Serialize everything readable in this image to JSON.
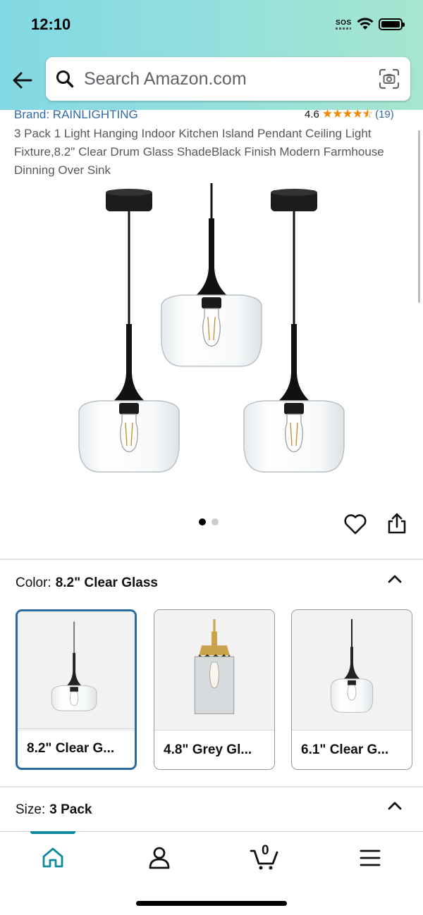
{
  "status_bar": {
    "time": "12:10",
    "sos": "SOS"
  },
  "search": {
    "placeholder": "Search Amazon.com"
  },
  "product": {
    "brand": "Brand: RAINLIGHTING",
    "rating_value": "4.6",
    "rating_stars": 4.6,
    "rating_count": "(19)",
    "title": "3 Pack 1 Light Hanging Indoor Kitchen Island Pendant Ceiling Light Fixture,8.2\" Clear Drum Glass ShadeBlack Finish Modern Farmhouse Dinning Over Sink"
  },
  "image_carousel": {
    "total": 2,
    "active_index": 0
  },
  "color": {
    "label": "Color:",
    "selected": "8.2\" Clear Glass",
    "options": [
      {
        "label": "8.2\" Clear G..."
      },
      {
        "label": "4.8\" Grey Gl..."
      },
      {
        "label": "6.1\" Clear G..."
      }
    ]
  },
  "size": {
    "label": "Size:",
    "selected": "3 Pack"
  },
  "bottom_nav": {
    "cart_count": "0"
  },
  "colors": {
    "accent": "#0e8a9c",
    "link": "#2f6aa7",
    "star": "#f08804",
    "selected_border": "#2b6aa1"
  }
}
